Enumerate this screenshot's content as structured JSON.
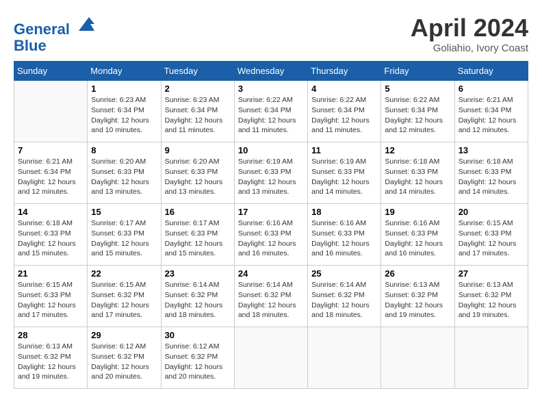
{
  "header": {
    "logo_line1": "General",
    "logo_line2": "Blue",
    "month_title": "April 2024",
    "location": "Goliahio, Ivory Coast"
  },
  "days_of_week": [
    "Sunday",
    "Monday",
    "Tuesday",
    "Wednesday",
    "Thursday",
    "Friday",
    "Saturday"
  ],
  "weeks": [
    [
      {
        "day": "",
        "info": ""
      },
      {
        "day": "1",
        "info": "Sunrise: 6:23 AM\nSunset: 6:34 PM\nDaylight: 12 hours\nand 10 minutes."
      },
      {
        "day": "2",
        "info": "Sunrise: 6:23 AM\nSunset: 6:34 PM\nDaylight: 12 hours\nand 11 minutes."
      },
      {
        "day": "3",
        "info": "Sunrise: 6:22 AM\nSunset: 6:34 PM\nDaylight: 12 hours\nand 11 minutes."
      },
      {
        "day": "4",
        "info": "Sunrise: 6:22 AM\nSunset: 6:34 PM\nDaylight: 12 hours\nand 11 minutes."
      },
      {
        "day": "5",
        "info": "Sunrise: 6:22 AM\nSunset: 6:34 PM\nDaylight: 12 hours\nand 12 minutes."
      },
      {
        "day": "6",
        "info": "Sunrise: 6:21 AM\nSunset: 6:34 PM\nDaylight: 12 hours\nand 12 minutes."
      }
    ],
    [
      {
        "day": "7",
        "info": "Sunrise: 6:21 AM\nSunset: 6:34 PM\nDaylight: 12 hours\nand 12 minutes."
      },
      {
        "day": "8",
        "info": "Sunrise: 6:20 AM\nSunset: 6:33 PM\nDaylight: 12 hours\nand 13 minutes."
      },
      {
        "day": "9",
        "info": "Sunrise: 6:20 AM\nSunset: 6:33 PM\nDaylight: 12 hours\nand 13 minutes."
      },
      {
        "day": "10",
        "info": "Sunrise: 6:19 AM\nSunset: 6:33 PM\nDaylight: 12 hours\nand 13 minutes."
      },
      {
        "day": "11",
        "info": "Sunrise: 6:19 AM\nSunset: 6:33 PM\nDaylight: 12 hours\nand 14 minutes."
      },
      {
        "day": "12",
        "info": "Sunrise: 6:18 AM\nSunset: 6:33 PM\nDaylight: 12 hours\nand 14 minutes."
      },
      {
        "day": "13",
        "info": "Sunrise: 6:18 AM\nSunset: 6:33 PM\nDaylight: 12 hours\nand 14 minutes."
      }
    ],
    [
      {
        "day": "14",
        "info": "Sunrise: 6:18 AM\nSunset: 6:33 PM\nDaylight: 12 hours\nand 15 minutes."
      },
      {
        "day": "15",
        "info": "Sunrise: 6:17 AM\nSunset: 6:33 PM\nDaylight: 12 hours\nand 15 minutes."
      },
      {
        "day": "16",
        "info": "Sunrise: 6:17 AM\nSunset: 6:33 PM\nDaylight: 12 hours\nand 15 minutes."
      },
      {
        "day": "17",
        "info": "Sunrise: 6:16 AM\nSunset: 6:33 PM\nDaylight: 12 hours\nand 16 minutes."
      },
      {
        "day": "18",
        "info": "Sunrise: 6:16 AM\nSunset: 6:33 PM\nDaylight: 12 hours\nand 16 minutes."
      },
      {
        "day": "19",
        "info": "Sunrise: 6:16 AM\nSunset: 6:33 PM\nDaylight: 12 hours\nand 16 minutes."
      },
      {
        "day": "20",
        "info": "Sunrise: 6:15 AM\nSunset: 6:33 PM\nDaylight: 12 hours\nand 17 minutes."
      }
    ],
    [
      {
        "day": "21",
        "info": "Sunrise: 6:15 AM\nSunset: 6:33 PM\nDaylight: 12 hours\nand 17 minutes."
      },
      {
        "day": "22",
        "info": "Sunrise: 6:15 AM\nSunset: 6:32 PM\nDaylight: 12 hours\nand 17 minutes."
      },
      {
        "day": "23",
        "info": "Sunrise: 6:14 AM\nSunset: 6:32 PM\nDaylight: 12 hours\nand 18 minutes."
      },
      {
        "day": "24",
        "info": "Sunrise: 6:14 AM\nSunset: 6:32 PM\nDaylight: 12 hours\nand 18 minutes."
      },
      {
        "day": "25",
        "info": "Sunrise: 6:14 AM\nSunset: 6:32 PM\nDaylight: 12 hours\nand 18 minutes."
      },
      {
        "day": "26",
        "info": "Sunrise: 6:13 AM\nSunset: 6:32 PM\nDaylight: 12 hours\nand 19 minutes."
      },
      {
        "day": "27",
        "info": "Sunrise: 6:13 AM\nSunset: 6:32 PM\nDaylight: 12 hours\nand 19 minutes."
      }
    ],
    [
      {
        "day": "28",
        "info": "Sunrise: 6:13 AM\nSunset: 6:32 PM\nDaylight: 12 hours\nand 19 minutes."
      },
      {
        "day": "29",
        "info": "Sunrise: 6:12 AM\nSunset: 6:32 PM\nDaylight: 12 hours\nand 20 minutes."
      },
      {
        "day": "30",
        "info": "Sunrise: 6:12 AM\nSunset: 6:32 PM\nDaylight: 12 hours\nand 20 minutes."
      },
      {
        "day": "",
        "info": ""
      },
      {
        "day": "",
        "info": ""
      },
      {
        "day": "",
        "info": ""
      },
      {
        "day": "",
        "info": ""
      }
    ]
  ]
}
